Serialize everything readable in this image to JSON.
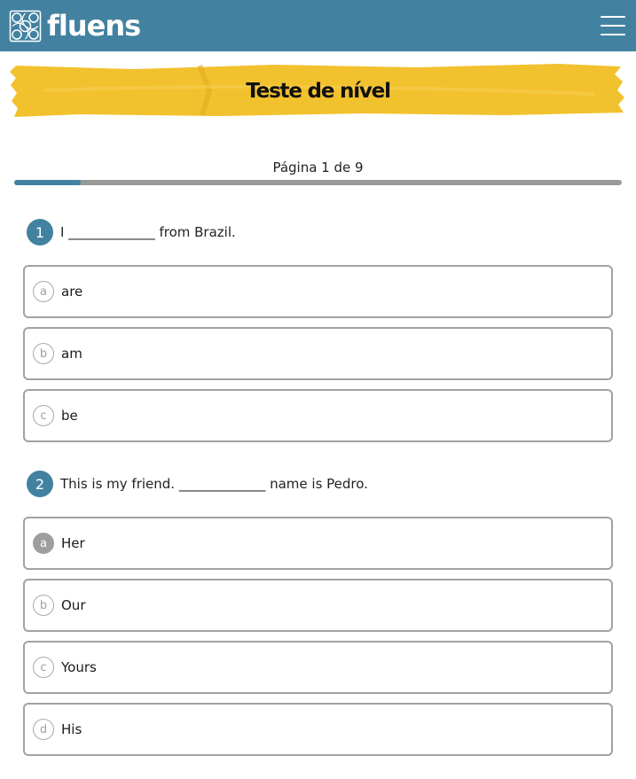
{
  "header": {
    "brand": "fluens",
    "logo_icon": "geometric-knot-logo",
    "menu_icon": "hamburger-menu-icon",
    "bg_color": "#4282a0"
  },
  "banner": {
    "title": "Teste de nível",
    "color": "#f2c12e"
  },
  "pagination": {
    "text": "Página 1 de 9",
    "progress": 0.11
  },
  "questions": [
    {
      "number": "1",
      "text": "I _____________ from Brazil.",
      "options": [
        {
          "letter": "a",
          "label": "are",
          "selected": false
        },
        {
          "letter": "b",
          "label": "am",
          "selected": false
        },
        {
          "letter": "c",
          "label": "be",
          "selected": false
        }
      ]
    },
    {
      "number": "2",
      "text": "This is my friend. _____________ name is Pedro.",
      "options": [
        {
          "letter": "a",
          "label": "Her",
          "selected": true
        },
        {
          "letter": "b",
          "label": "Our",
          "selected": false
        },
        {
          "letter": "c",
          "label": "Yours",
          "selected": false
        },
        {
          "letter": "d",
          "label": "His",
          "selected": false
        }
      ]
    }
  ]
}
